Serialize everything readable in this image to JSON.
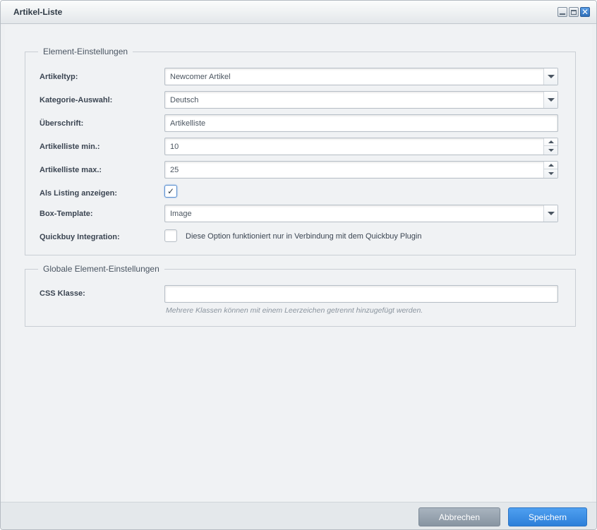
{
  "window": {
    "title": "Artikel-Liste",
    "controls": [
      "minimize-icon",
      "maximize-icon",
      "close-icon"
    ],
    "close_glyph": "✕"
  },
  "element_settings": {
    "legend": "Element-Einstellungen",
    "artikeltyp": {
      "label": "Artikeltyp:",
      "value": "Newcomer Artikel"
    },
    "kategorie": {
      "label": "Kategorie-Auswahl:",
      "value": "Deutsch"
    },
    "ueberschrift": {
      "label": "Überschrift:",
      "value": "Artikelliste"
    },
    "min": {
      "label": "Artikelliste min.:",
      "value": "10"
    },
    "max": {
      "label": "Artikelliste max.:",
      "value": "25"
    },
    "listing": {
      "label": "Als Listing anzeigen:",
      "checked": true,
      "glyph": "✓"
    },
    "box_template": {
      "label": "Box-Template:",
      "value": "Image"
    },
    "quickbuy": {
      "label": "Quickbuy Integration:",
      "checked": false,
      "note": "Diese Option funktioniert nur in Verbindung mit dem Quickbuy Plugin"
    }
  },
  "global_settings": {
    "legend": "Globale Element-Einstellungen",
    "css_klasse": {
      "label": "CSS Klasse:",
      "value": "",
      "help": "Mehrere Klassen können mit einem Leerzeichen getrennt hinzugefügt werden."
    }
  },
  "footer": {
    "cancel_label": "Abbrechen",
    "save_label": "Speichern"
  },
  "colors": {
    "accent": "#2d7fd9",
    "cancel": "#8794a1",
    "panel": "#f0f2f4"
  }
}
